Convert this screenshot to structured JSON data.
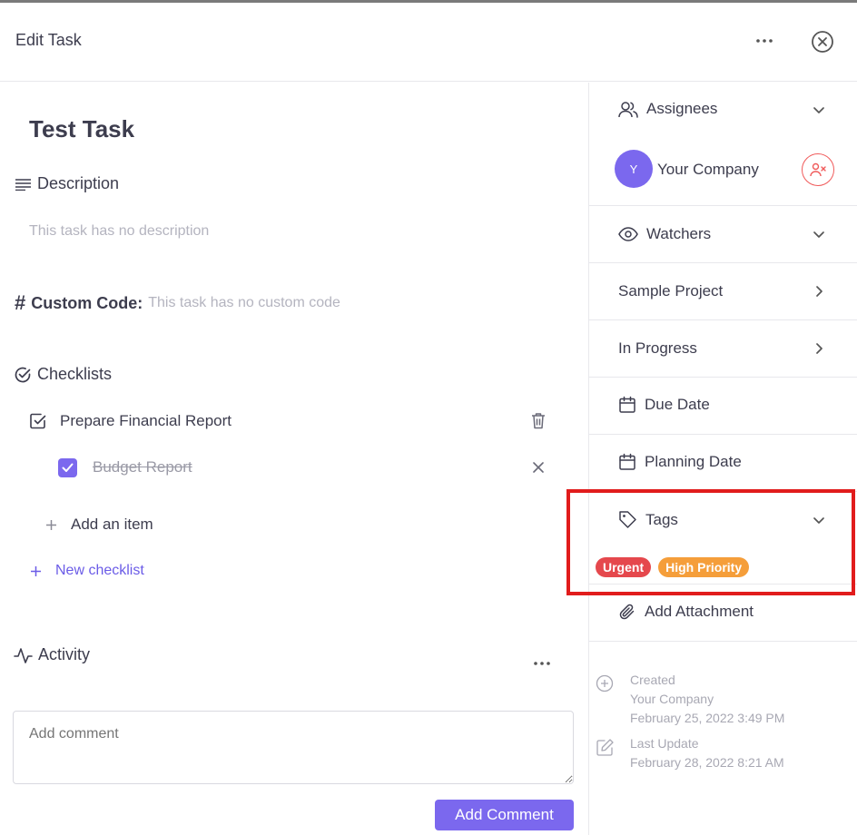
{
  "header": {
    "title": "Edit Task"
  },
  "task": {
    "title": "Test Task"
  },
  "description": {
    "label": "Description",
    "empty_text": "This task has no description"
  },
  "custom_code": {
    "label": "Custom Code:",
    "empty_text": "This task has no custom code"
  },
  "checklists": {
    "label": "Checklists",
    "list": {
      "title": "Prepare Financial Report",
      "items": [
        {
          "label": "Budget Report",
          "checked": true
        }
      ]
    },
    "add_item_label": "Add an item",
    "new_checklist_label": "New checklist"
  },
  "activity": {
    "label": "Activity",
    "comment_placeholder": "Add comment",
    "add_comment_label": "Add Comment"
  },
  "sidebar": {
    "assignees_label": "Assignees",
    "assignee": {
      "initial": "Y",
      "name": "Your Company"
    },
    "watchers_label": "Watchers",
    "project_label": "Sample Project",
    "status_label": "In Progress",
    "due_date_label": "Due Date",
    "planning_date_label": "Planning Date",
    "tags_label": "Tags",
    "tags": [
      {
        "label": "Urgent",
        "color": "#e5484d"
      },
      {
        "label": "High Priority",
        "color": "#f59e3a"
      }
    ],
    "attachment_label": "Add Attachment",
    "created": {
      "label": "Created",
      "by": "Your Company",
      "date": "February 25, 2022 3:49 PM"
    },
    "updated": {
      "label": "Last Update",
      "date": "February 28, 2022 8:21 AM"
    }
  },
  "colors": {
    "accent": "#7b68ee",
    "danger": "#f05a5a",
    "highlight": "#e11c1c"
  }
}
